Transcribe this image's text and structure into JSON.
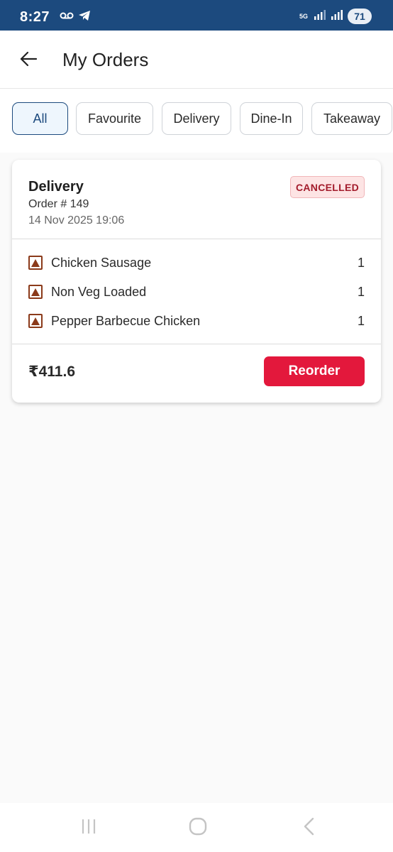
{
  "status_bar": {
    "time": "8:27",
    "network_label": "5G",
    "battery": "71"
  },
  "header": {
    "title": "My Orders"
  },
  "filters": [
    {
      "label": "All",
      "active": true
    },
    {
      "label": "Favourite",
      "active": false
    },
    {
      "label": "Delivery",
      "active": false
    },
    {
      "label": "Dine-In",
      "active": false
    },
    {
      "label": "Takeaway",
      "active": false
    }
  ],
  "order": {
    "type": "Delivery",
    "number": "Order # 149",
    "date": "14 Nov 2025 19:06",
    "status": "CANCELLED",
    "items": [
      {
        "name": "Chicken Sausage",
        "qty": "1"
      },
      {
        "name": "Non Veg Loaded",
        "qty": "1"
      },
      {
        "name": "Pepper Barbecue Chicken",
        "qty": "1"
      }
    ],
    "total": "₹411.6",
    "reorder_label": "Reorder"
  },
  "colors": {
    "status_bar": "#1c4a7e",
    "accent_red": "#e3183c",
    "nonveg_brown": "#8b3a1a",
    "active_chip": "#1c4a7e"
  }
}
